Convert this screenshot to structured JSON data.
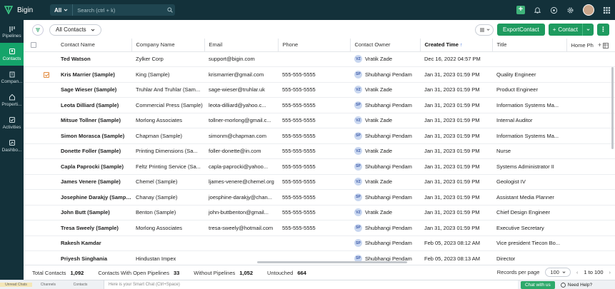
{
  "app": {
    "name": "Bigin"
  },
  "search": {
    "scope": "All",
    "placeholder": "Search (ctrl + k)"
  },
  "sidebar": {
    "items": [
      {
        "label": "Pipelines",
        "icon": "pipeline-icon",
        "active": false
      },
      {
        "label": "Contacts",
        "icon": "contacts-icon",
        "active": true
      },
      {
        "label": "Compan...",
        "icon": "company-icon",
        "active": false
      },
      {
        "label": "Properti...",
        "icon": "property-icon",
        "active": false
      },
      {
        "label": "Activities",
        "icon": "activities-icon",
        "active": false
      },
      {
        "label": "Dashbo...",
        "icon": "dashboard-icon",
        "active": false
      }
    ]
  },
  "toolbar": {
    "view": "All Contacts",
    "export_label": "ExportContact",
    "add_label": "Contact"
  },
  "table": {
    "columns": [
      "Contact Name",
      "Company Name",
      "Email",
      "Phone",
      "Contact Owner",
      "Created Time",
      "Title",
      "Home Ph"
    ],
    "sorted_column": "Created Time",
    "rows": [
      {
        "name": "Ted Watson",
        "company": "Zylker Corp",
        "email": "support@bigin.com",
        "phone": "",
        "owner": "Vratik Zade",
        "owner_initials": "VZ",
        "created": "Dec 16, 2022 04:57 PM",
        "title": "",
        "checked": false
      },
      {
        "name": "Kris Marrier (Sample)",
        "company": "King (Sample)",
        "email": "krismarrier@gmail.com",
        "phone": "555-555-5555",
        "owner": "Shubhangi Pendam",
        "owner_initials": "SP",
        "created": "Jan 31, 2023 01:59 PM",
        "title": "Quality Engineer",
        "checked": true
      },
      {
        "name": "Sage Wieser (Sample)",
        "company": "Truhlar And Truhlar (Sam...",
        "email": "sage-wieser@truhlar.uk",
        "phone": "555-555-5555",
        "owner": "Vratik Zade",
        "owner_initials": "VZ",
        "created": "Jan 31, 2023 01:59 PM",
        "title": "Product Engineer",
        "checked": false
      },
      {
        "name": "Leota Dilliard (Sample)",
        "company": "Commercial Press (Sample)",
        "email": "leota-dilliard@yahoo.c...",
        "phone": "555-555-5555",
        "owner": "Shubhangi Pendam",
        "owner_initials": "SP",
        "created": "Jan 31, 2023 01:59 PM",
        "title": "Information Systems Ma...",
        "checked": false
      },
      {
        "name": "Mitsue Tollner (Sample)",
        "company": "Morlong Associates",
        "email": "tollner-morlong@gmail.c...",
        "phone": "555-555-5555",
        "owner": "Vratik Zade",
        "owner_initials": "VZ",
        "created": "Jan 31, 2023 01:59 PM",
        "title": "Internal Auditor",
        "checked": false
      },
      {
        "name": "Simon Morasca (Sample)",
        "company": "Chapman (Sample)",
        "email": "simonm@chapman.com",
        "phone": "555-555-5555",
        "owner": "Shubhangi Pendam",
        "owner_initials": "SP",
        "created": "Jan 31, 2023 01:59 PM",
        "title": "Information Systems Ma...",
        "checked": false
      },
      {
        "name": "Donette Foller (Sample)",
        "company": "Printing Dimensions (Sa...",
        "email": "foller-donette@in.com",
        "phone": "555-555-5555",
        "owner": "Vratik Zade",
        "owner_initials": "VZ",
        "created": "Jan 31, 2023 01:59 PM",
        "title": "Nurse",
        "checked": false
      },
      {
        "name": "Capla Paprocki (Sample)",
        "company": "Feltz Printing Service (Sa...",
        "email": "capla-paprocki@yahoo...",
        "phone": "555-555-5555",
        "owner": "Shubhangi Pendam",
        "owner_initials": "SP",
        "created": "Jan 31, 2023 01:59 PM",
        "title": "Systems Administrator II",
        "checked": false
      },
      {
        "name": "James Venere (Sample)",
        "company": "Chemel (Sample)",
        "email": "ljames-venere@chemel.org",
        "phone": "555-555-5555",
        "owner": "Vratik Zade",
        "owner_initials": "VZ",
        "created": "Jan 31, 2023 01:59 PM",
        "title": "Geologist IV",
        "checked": false
      },
      {
        "name": "Josephine Darakjy (Sample)",
        "company": "Chanay (Sample)",
        "email": "joesphine-darakjy@chan...",
        "phone": "555-555-5555",
        "owner": "Shubhangi Pendam",
        "owner_initials": "SP",
        "created": "Jan 31, 2023 01:59 PM",
        "title": "Assistant Media Planner",
        "checked": false
      },
      {
        "name": "John Butt (Sample)",
        "company": "Benton (Sample)",
        "email": "john-buttbenton@gmail...",
        "phone": "555-555-5555",
        "owner": "Vratik Zade",
        "owner_initials": "VZ",
        "created": "Jan 31, 2023 01:59 PM",
        "title": "Chief Design Engineer",
        "checked": false
      },
      {
        "name": "Tresa Sweely (Sample)",
        "company": "Morlong Associates",
        "email": "tresa-sweely@hotmail.com",
        "phone": "555-555-5555",
        "owner": "Shubhangi Pendam",
        "owner_initials": "SP",
        "created": "Jan 31, 2023 01:59 PM",
        "title": "Executive Secretary",
        "checked": false
      },
      {
        "name": "Rakesh Kamdar",
        "company": "",
        "email": "",
        "phone": "",
        "owner": "Shubhangi Pendam",
        "owner_initials": "SP",
        "created": "Feb 05, 2023 08:12 AM",
        "title": "Vice president Tiecon Bo...",
        "checked": false
      },
      {
        "name": "Priyesh Singhania",
        "company": "Hindustan Impex",
        "email": "",
        "phone": "",
        "owner": "Shubhangi Pendam",
        "owner_initials": "SP",
        "created": "Feb 05, 2023 08:13 AM",
        "title": "Director",
        "checked": false
      }
    ]
  },
  "summary": {
    "total_label": "Total Contacts",
    "total_value": "1,092",
    "open_label": "Contacts With Open Pipelines",
    "open_value": "33",
    "without_label": "Without Pipelines",
    "without_value": "1,052",
    "untouched_label": "Untouched",
    "untouched_value": "664",
    "rpp_label": "Records per page",
    "rpp_value": "100",
    "range": "1 to 100"
  },
  "bottombar": {
    "items": [
      "Unread Chats",
      "Channels",
      "Contacts"
    ],
    "smartchat_placeholder": "Here is your Smart Chat (Ctrl+Space)",
    "chat_label": "Chat with us",
    "help_label": "Need Help?"
  },
  "colors": {
    "topbar": "#13313a",
    "accent": "#1e9b5f",
    "active_nav": "#14a46a"
  }
}
